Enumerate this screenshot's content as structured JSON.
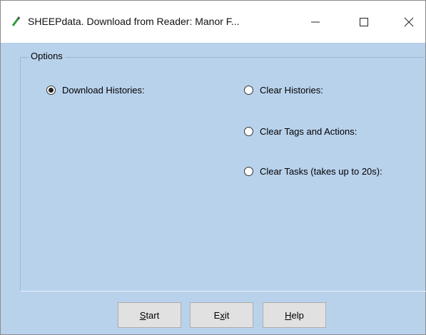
{
  "window": {
    "title": "SHEEPdata. Download from Reader: Manor F...",
    "icon": "pencil-icon",
    "controls": {
      "minimize_icon": "minimize-icon",
      "maximize_icon": "maximize-icon",
      "close_icon": "close-icon"
    }
  },
  "options": {
    "group_label": "Options",
    "download_histories": {
      "label": "Download Histories:",
      "selected": true
    },
    "clear_histories": {
      "label": "Clear Histories:",
      "selected": false
    },
    "clear_tags_actions": {
      "label": "Clear Tags and Actions:",
      "selected": false
    },
    "clear_tasks": {
      "label": "Clear Tasks (takes up to 20s):",
      "selected": false
    }
  },
  "buttons": {
    "start": {
      "mnemonic": "S",
      "rest": "tart"
    },
    "exit": {
      "pre": "E",
      "mnemonic": "x",
      "rest": "it"
    },
    "help": {
      "mnemonic": "H",
      "rest": "elp"
    }
  },
  "colors": {
    "client_background": "#b9d2ec",
    "button_face": "#e1e1e1",
    "icon_green": "#2e9d3a"
  }
}
